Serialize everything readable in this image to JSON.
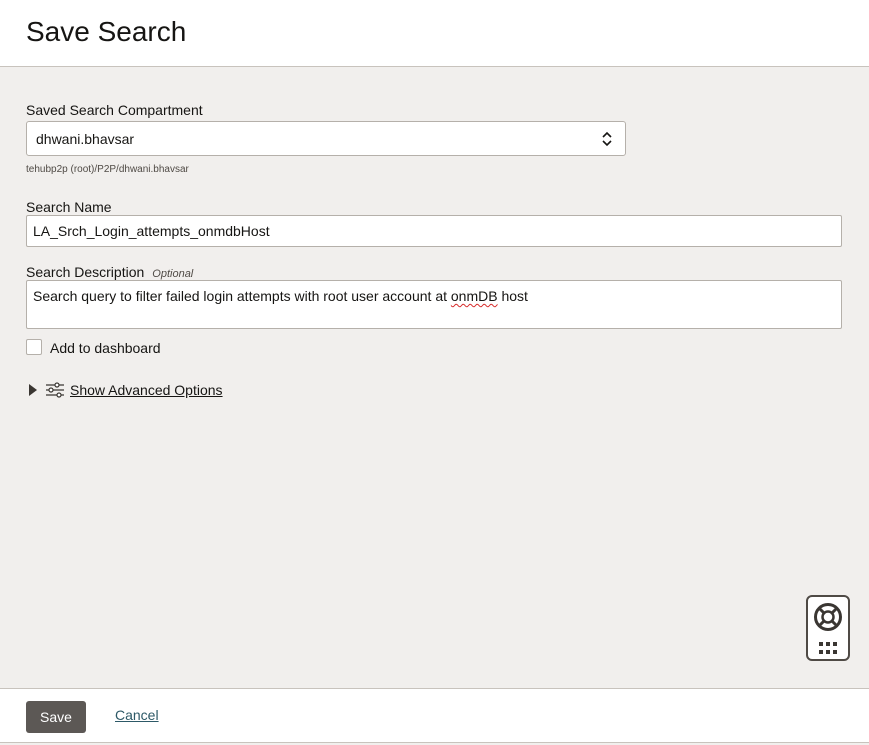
{
  "header": {
    "title": "Save Search"
  },
  "form": {
    "compartment": {
      "label": "Saved Search Compartment",
      "value": "dhwani.bhavsar",
      "hint": "tehubp2p (root)/P2P/dhwani.bhavsar"
    },
    "search_name": {
      "label": "Search Name",
      "value": "LA_Srch_Login_attempts_onmdbHost"
    },
    "search_description": {
      "label": "Search Description",
      "optional": "Optional",
      "value_before": "Search query to filter failed login attempts with root user account at ",
      "value_flagged": "onmDB",
      "value_after": " host"
    },
    "add_to_dashboard": {
      "label": "Add to dashboard",
      "checked": false
    },
    "advanced": {
      "label": "Show Advanced Options",
      "expanded": false
    }
  },
  "footer": {
    "save_label": "Save",
    "cancel_label": "Cancel"
  },
  "icons": {
    "select": "chevron-updown-icon",
    "expand": "triangle-right-icon",
    "options": "sliders-icon",
    "help": "lifebuoy-icon",
    "apps": "grid-icon"
  },
  "colors": {
    "save_button": "#5c5855",
    "link": "#2d5967",
    "page_bg": "#f1efed"
  }
}
